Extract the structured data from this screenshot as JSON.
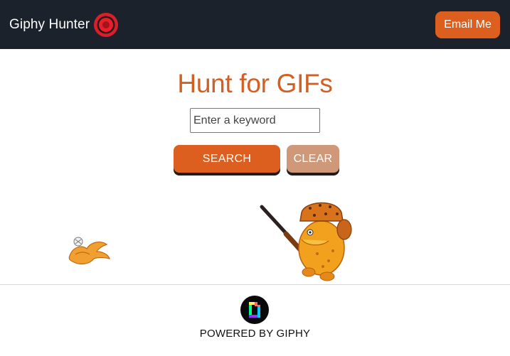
{
  "navbar": {
    "brand_text": "Giphy Hunter",
    "brand_icon": "target-icon",
    "email_button_label": "Email Me"
  },
  "hero": {
    "title": "Hunt for GIFs"
  },
  "search": {
    "placeholder": "Enter a keyword",
    "value": "",
    "search_button_label": "SEARCH",
    "clear_button_label": "CLEAR"
  },
  "results": {
    "gifs": [
      {
        "name": "flying-bird-gif"
      },
      {
        "name": "hunter-with-rifle-gif"
      }
    ]
  },
  "footer": {
    "logo_icon": "giphy-logo-icon",
    "powered_by": "POWERED BY GIPHY"
  },
  "colors": {
    "navbar_bg": "#1c222c",
    "accent": "#dc5f1f",
    "title": "#d35f22",
    "clear_button": "#cf9979"
  }
}
